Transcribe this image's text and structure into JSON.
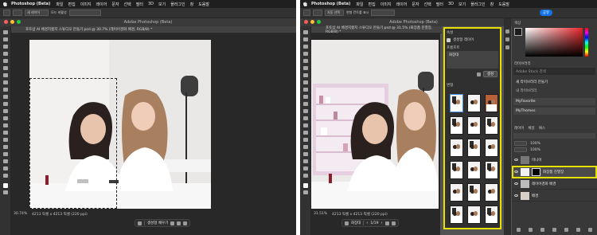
{
  "left": {
    "menubar": {
      "app": "Photoshop (Beta)",
      "items": [
        "파일",
        "편집",
        "이미지",
        "레이어",
        "문자",
        "선택",
        "필터",
        "3D",
        "보기",
        "플러그인",
        "창",
        "도움말"
      ]
    },
    "options": {
      "field": "새 레이어",
      "label": "모드 비활성"
    },
    "window_title": "Adobe Photoshop (Beta)",
    "doc_tab": "포토샵 AI 배경지웠지 스튜디오 만들기.psd @ 30.7% (레이어경화 배경, RGB/8) *",
    "status": "30.74%",
    "status_size": "4213 픽셀 x 4213 픽셀 (220 ppi)",
    "taskbar": {
      "label": "생성형 채우기"
    }
  },
  "right": {
    "menubar": {
      "app": "Photoshop (Beta)",
      "items": [
        "파일",
        "편집",
        "이미지",
        "레이어",
        "문자",
        "선택",
        "필터",
        "3D",
        "보기",
        "플러그인",
        "창",
        "도움말"
      ]
    },
    "options": {
      "field": "자동 선택",
      "label": "변형 컨트롤 표시"
    },
    "window_title": "Adobe Photoshop (Beta)",
    "doc_tab": "포토샵 AI 배경지웠지 스튜디오 만들기.psd @ 31.5% (화장품 진열장, RGB/8) *",
    "status": "31.51%",
    "status_size": "4213 픽셀 x 4213 픽셀 (220 ppi)",
    "taskbar": {
      "label": "화장대",
      "pages": "1/19"
    },
    "share_button": "공유",
    "properties": {
      "tab": "속성",
      "sub": "생성형 레이어",
      "prompt_label": "프롬프트",
      "prompt_value": "화장대",
      "generate": "생성",
      "variations_label": "변형"
    },
    "side_panels": {
      "color_tab": "색상",
      "libraries_tab": "라이브러리",
      "search_placeholder": "Adobe Stock 검색",
      "library_items": [
        "새 라이브러리 만들기",
        "내 라이브러리",
        "MyFavorite",
        "MyThemes"
      ]
    },
    "layers": {
      "tabs": [
        "레이어",
        "채널",
        "패스"
      ],
      "opacity": "100%",
      "fill": "100%",
      "items": [
        {
          "name": "미니어"
        },
        {
          "name": "화장품 진열장"
        },
        {
          "name": "레이어경화 배경"
        },
        {
          "name": "배경"
        }
      ]
    }
  },
  "colors": {
    "highlight": "#e7e000",
    "accent": "#1473e6",
    "chrome_dark": "#323232",
    "canvas_bg": "#282828"
  }
}
